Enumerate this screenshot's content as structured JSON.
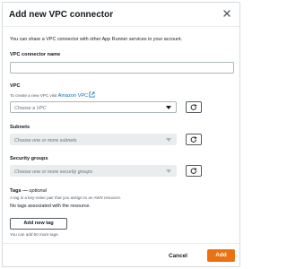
{
  "dialog": {
    "title": "Add new VPC connector",
    "intro": "You can share a VPC connector with other App Runner services in your account."
  },
  "fields": {
    "connector_name": {
      "label": "VPC connector name",
      "value": ""
    },
    "vpc": {
      "label": "VPC",
      "desc_prefix": "To create a new VPC visit",
      "desc_link": "Amazon VPC",
      "placeholder": "Choose a VPC"
    },
    "subnets": {
      "label": "Subnets",
      "placeholder": "Choose one or more subnets"
    },
    "security_groups": {
      "label": "Security groups",
      "placeholder": "Choose one or more security groups"
    }
  },
  "tags": {
    "label": "Tags",
    "optional": "optional",
    "desc": "A tag is a key-value pair that you assign to an AWS resource.",
    "empty": "No tags associated with the resource.",
    "add_button": "Add new tag",
    "limit": "You can add 50 more tags."
  },
  "footer": {
    "cancel": "Cancel",
    "add": "Add"
  },
  "colors": {
    "primary": "#ec7211",
    "link": "#0073bb",
    "border": "#aab7b8"
  },
  "icons": [
    "close-icon",
    "external-link-icon",
    "caret-down-icon",
    "refresh-icon"
  ]
}
